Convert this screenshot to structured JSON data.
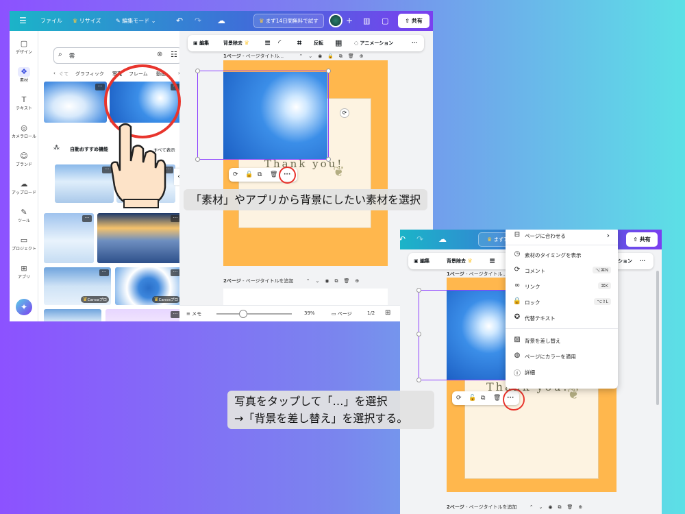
{
  "top": {
    "file": "ファイル",
    "resize": "リサイズ",
    "edit_mode": "編集モード",
    "trial": "まず14日間無料で試す",
    "trial_short": "まず14",
    "share": "共有"
  },
  "rail": {
    "items": [
      {
        "icon": "▢",
        "label": "デザイン"
      },
      {
        "icon": "❖",
        "label": "素材"
      },
      {
        "icon": "T",
        "label": "テキスト"
      },
      {
        "icon": "◎",
        "label": "カメラロール"
      },
      {
        "icon": "☺",
        "label": "ブランド"
      },
      {
        "icon": "☁",
        "label": "アップロード"
      },
      {
        "icon": "✎",
        "label": "ツール"
      },
      {
        "icon": "▭",
        "label": "プロジェクト"
      },
      {
        "icon": "⊞",
        "label": "アプリ"
      }
    ]
  },
  "panel": {
    "search_value": "雲",
    "tabs": [
      "ぐて",
      "グラフィック",
      "写真",
      "フレーム",
      "動画"
    ],
    "auto_recommend": "自動おすすめ機能",
    "see_all": "すべて表示",
    "badge": "Canvaプロ"
  },
  "editor": {
    "ctx": {
      "edit": "編集",
      "bg_remove": "背景除去",
      "flip": "反転",
      "animation": "アニメーション"
    },
    "page1": "1ページ",
    "page1_title": "ページタイトル...",
    "page2": "2ページ",
    "page2_title": "ページタイトルを追加",
    "thank": "Thank you!",
    "memo": "メモ",
    "zoom": "39%",
    "pages_label": "ページ",
    "page_count": "1/2"
  },
  "menu": {
    "items": [
      {
        "icon": "⊟",
        "label": "ページに合わせる",
        "key": "›"
      },
      {
        "icon": "◷",
        "label": "素材のタイミングを表示",
        "key": ""
      },
      {
        "icon": "⟳",
        "label": "コメント",
        "key": "⌥⌘N"
      },
      {
        "icon": "∞",
        "label": "リンク",
        "key": "⌘K"
      },
      {
        "icon": "🔒",
        "label": "ロック",
        "key": "⌥⇧L"
      },
      {
        "icon": "✪",
        "label": "代替テキスト",
        "key": ""
      },
      {
        "icon": "▨",
        "label": "背景を差し替え",
        "key": ""
      },
      {
        "icon": "◍",
        "label": "ページにカラーを適用",
        "key": ""
      },
      {
        "icon": "ⓘ",
        "label": "詳細",
        "key": ""
      }
    ]
  },
  "captions": {
    "one": "「素材」やアプリから背景にしたい素材を選択",
    "two_line1": "写真をタップして「…」を選択",
    "two_line2": "→「背景を差し替え」を選択する。"
  },
  "colors": {
    "accent": "#8b3dff",
    "highlight": "#e8352d",
    "card_orange": "#ffb74d"
  }
}
